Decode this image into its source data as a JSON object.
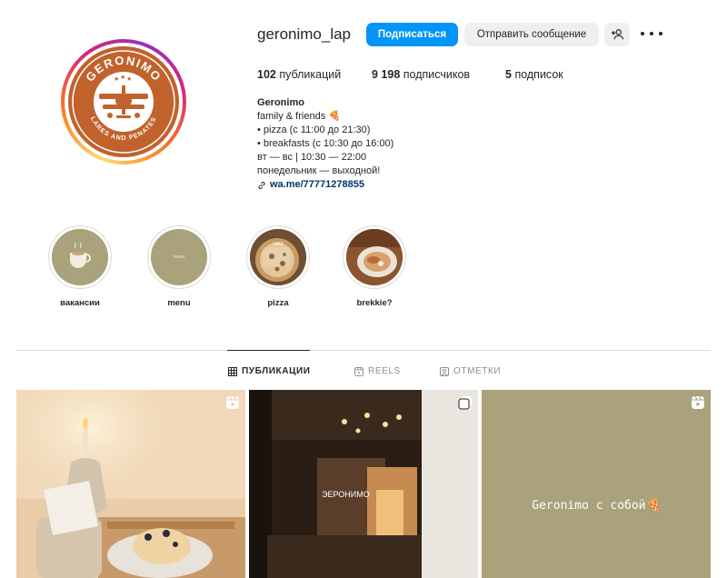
{
  "profile": {
    "username": "geronimo_lap",
    "follow_label": "Подписаться",
    "message_label": "Отправить сообщение",
    "avatar_logo": {
      "top_text": "GERONIMO",
      "bottom_text": "LARES AND PENATES",
      "brand_color": "#c1622d"
    }
  },
  "stats": {
    "posts_count": "102",
    "posts_label": "публикаций",
    "followers_count": "9 198",
    "followers_label": "подписчиков",
    "following_count": "5",
    "following_label": "подписок"
  },
  "bio": {
    "name": "Geronimo",
    "lines": [
      "family & friends 🍕",
      "• pizza (с 11:00 до 21:30)",
      "• breakfasts (с 10:30 до 16:00)",
      "вт — вс | 10:30 — 22:00",
      "понедельник — выходной!"
    ],
    "link": "wa.me/77771278855"
  },
  "highlights": [
    {
      "label": "вакансии",
      "color": "#a9a27a",
      "inner_text": ""
    },
    {
      "label": "menu",
      "color": "#a9a27a",
      "inner_text": "menu"
    },
    {
      "label": "pizza",
      "color": "#8b6a4a",
      "inner_text": "НАШ"
    },
    {
      "label": "brekkie?",
      "color": "#7a4a2a",
      "inner_text": ""
    }
  ],
  "tabs": [
    {
      "label": "ПУБЛИКАЦИИ",
      "icon": "grid-icon",
      "active": true
    },
    {
      "label": "REELS",
      "icon": "reels-icon",
      "active": false
    },
    {
      "label": "ОТМЕТКИ",
      "icon": "tagged-icon",
      "active": false
    }
  ],
  "posts": [
    {
      "type": "reel",
      "badge_icon": "reels-icon",
      "caption": ""
    },
    {
      "type": "carousel",
      "badge_icon": "carousel-icon",
      "caption": ""
    },
    {
      "type": "reel",
      "badge_icon": "reels-icon",
      "caption": "Geronimo с собой🍕",
      "bg_color": "#a9a27a"
    }
  ],
  "colors": {
    "accent": "#0095f6",
    "link": "#00376b",
    "secondary_button": "#efefef",
    "divider": "#dbdbdb"
  }
}
